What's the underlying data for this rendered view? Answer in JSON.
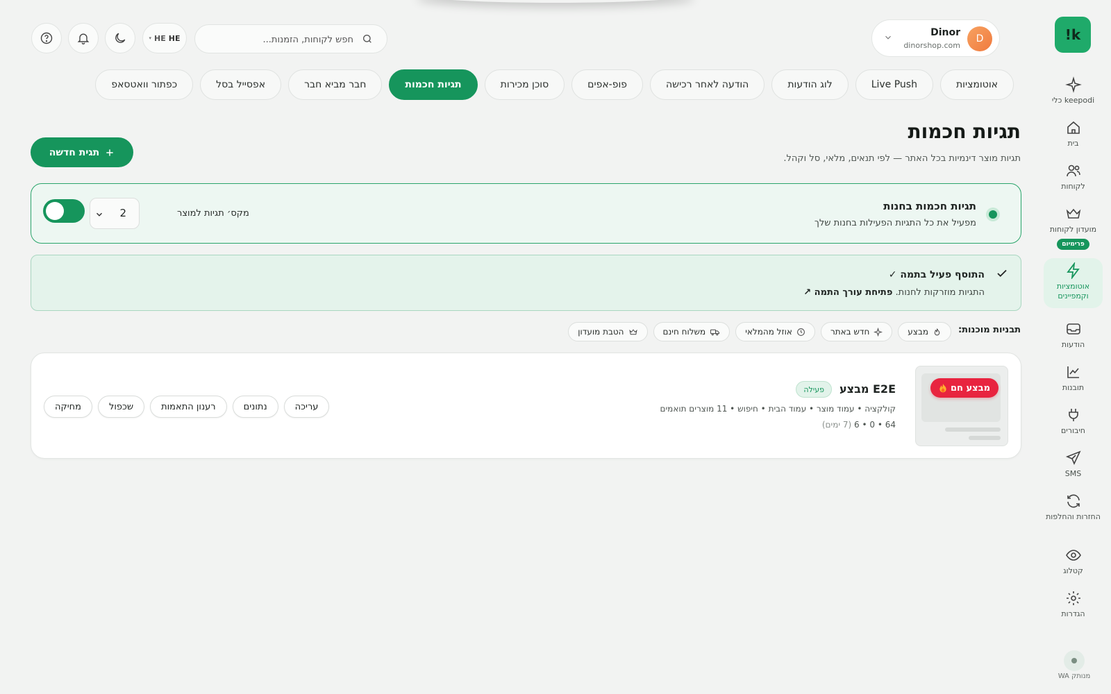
{
  "sidebar": {
    "logo": "!k",
    "items": [
      {
        "label": "כלי keepodi",
        "icon": "sparkle-icon"
      },
      {
        "label": "בית",
        "icon": "home-icon"
      },
      {
        "label": "לקוחות",
        "icon": "users-icon"
      },
      {
        "label": "מועדון לקוחות",
        "icon": "crown-icon",
        "badge": "פרימיום"
      },
      {
        "label": "אוטומציות וקמפיינים",
        "icon": "lightning-icon",
        "active": true
      },
      {
        "label": "הודעות",
        "icon": "inbox-icon"
      },
      {
        "label": "תובנות",
        "icon": "chart-icon"
      },
      {
        "label": "חיבורים",
        "icon": "plug-icon"
      },
      {
        "label": "SMS",
        "icon": "send-icon"
      },
      {
        "label": "החזרות והחלפות",
        "icon": "refresh-icon"
      },
      {
        "label": "קטלוג",
        "icon": "eye-icon"
      },
      {
        "label": "הגדרות",
        "icon": "gear-icon"
      }
    ],
    "wa_status": "WA מנותק"
  },
  "topbar": {
    "user": {
      "name": "Dinor",
      "domain": "dinorshop.com",
      "initial": "D"
    },
    "search_placeholder": "חפש לקוחות, הזמנות...",
    "lang": "HE",
    "lang_sub": "HE"
  },
  "tabs": [
    "אוטומציות",
    "Live Push",
    "לוג הודעות",
    "הודעה לאחר רכישה",
    "פופ-אפים",
    "סוכן מכירות",
    "תגיות חכמות",
    "חבר מביא חבר",
    "אפסייל בסל",
    "כפתור וואטסאפ"
  ],
  "active_tab": "תגיות חכמות",
  "page": {
    "title": "תגיות חכמות",
    "subtitle": "תגיות מוצר דינמיות בכל האתר — לפי תנאים, מלאי, סל וקהל.",
    "new_button": "תגית חדשה"
  },
  "toggle_card": {
    "title": "תגיות חכמות בחנות",
    "desc": "מפעיל את כל התגיות הפעילות בחנות שלך",
    "max_label": "מקס׳ תגיות למוצר",
    "max_value": "2",
    "enabled": true
  },
  "theme_card": {
    "title": "התוסף פעיל בתמה ✓",
    "desc": "התגיות מוזרקות לחנות.",
    "link": "פתיחת עורך התמה ↗"
  },
  "templates": {
    "label": "תבניות מוכנות:",
    "items": [
      {
        "label": "מבצע",
        "icon": "flame-icon"
      },
      {
        "label": "חדש באתר",
        "icon": "sparkle-icon"
      },
      {
        "label": "אוזל מהמלאי",
        "icon": "clock-icon"
      },
      {
        "label": "משלוח חינם",
        "icon": "truck-icon"
      },
      {
        "label": "הטבת מועדון",
        "icon": "crown-icon"
      }
    ]
  },
  "tag": {
    "badge": "מבצע חם",
    "name": "E2E מבצע",
    "status": "פעילה",
    "meta": "קולקציה • עמוד מוצר • עמוד הבית • חיפוש • 11 מוצרים תואמים",
    "stats": "64 • 0 • 6",
    "stats_note": "(7 ימים)",
    "actions": [
      "עריכה",
      "נתונים",
      "רענון התאמות",
      "שכפול",
      "מחיקה"
    ]
  }
}
